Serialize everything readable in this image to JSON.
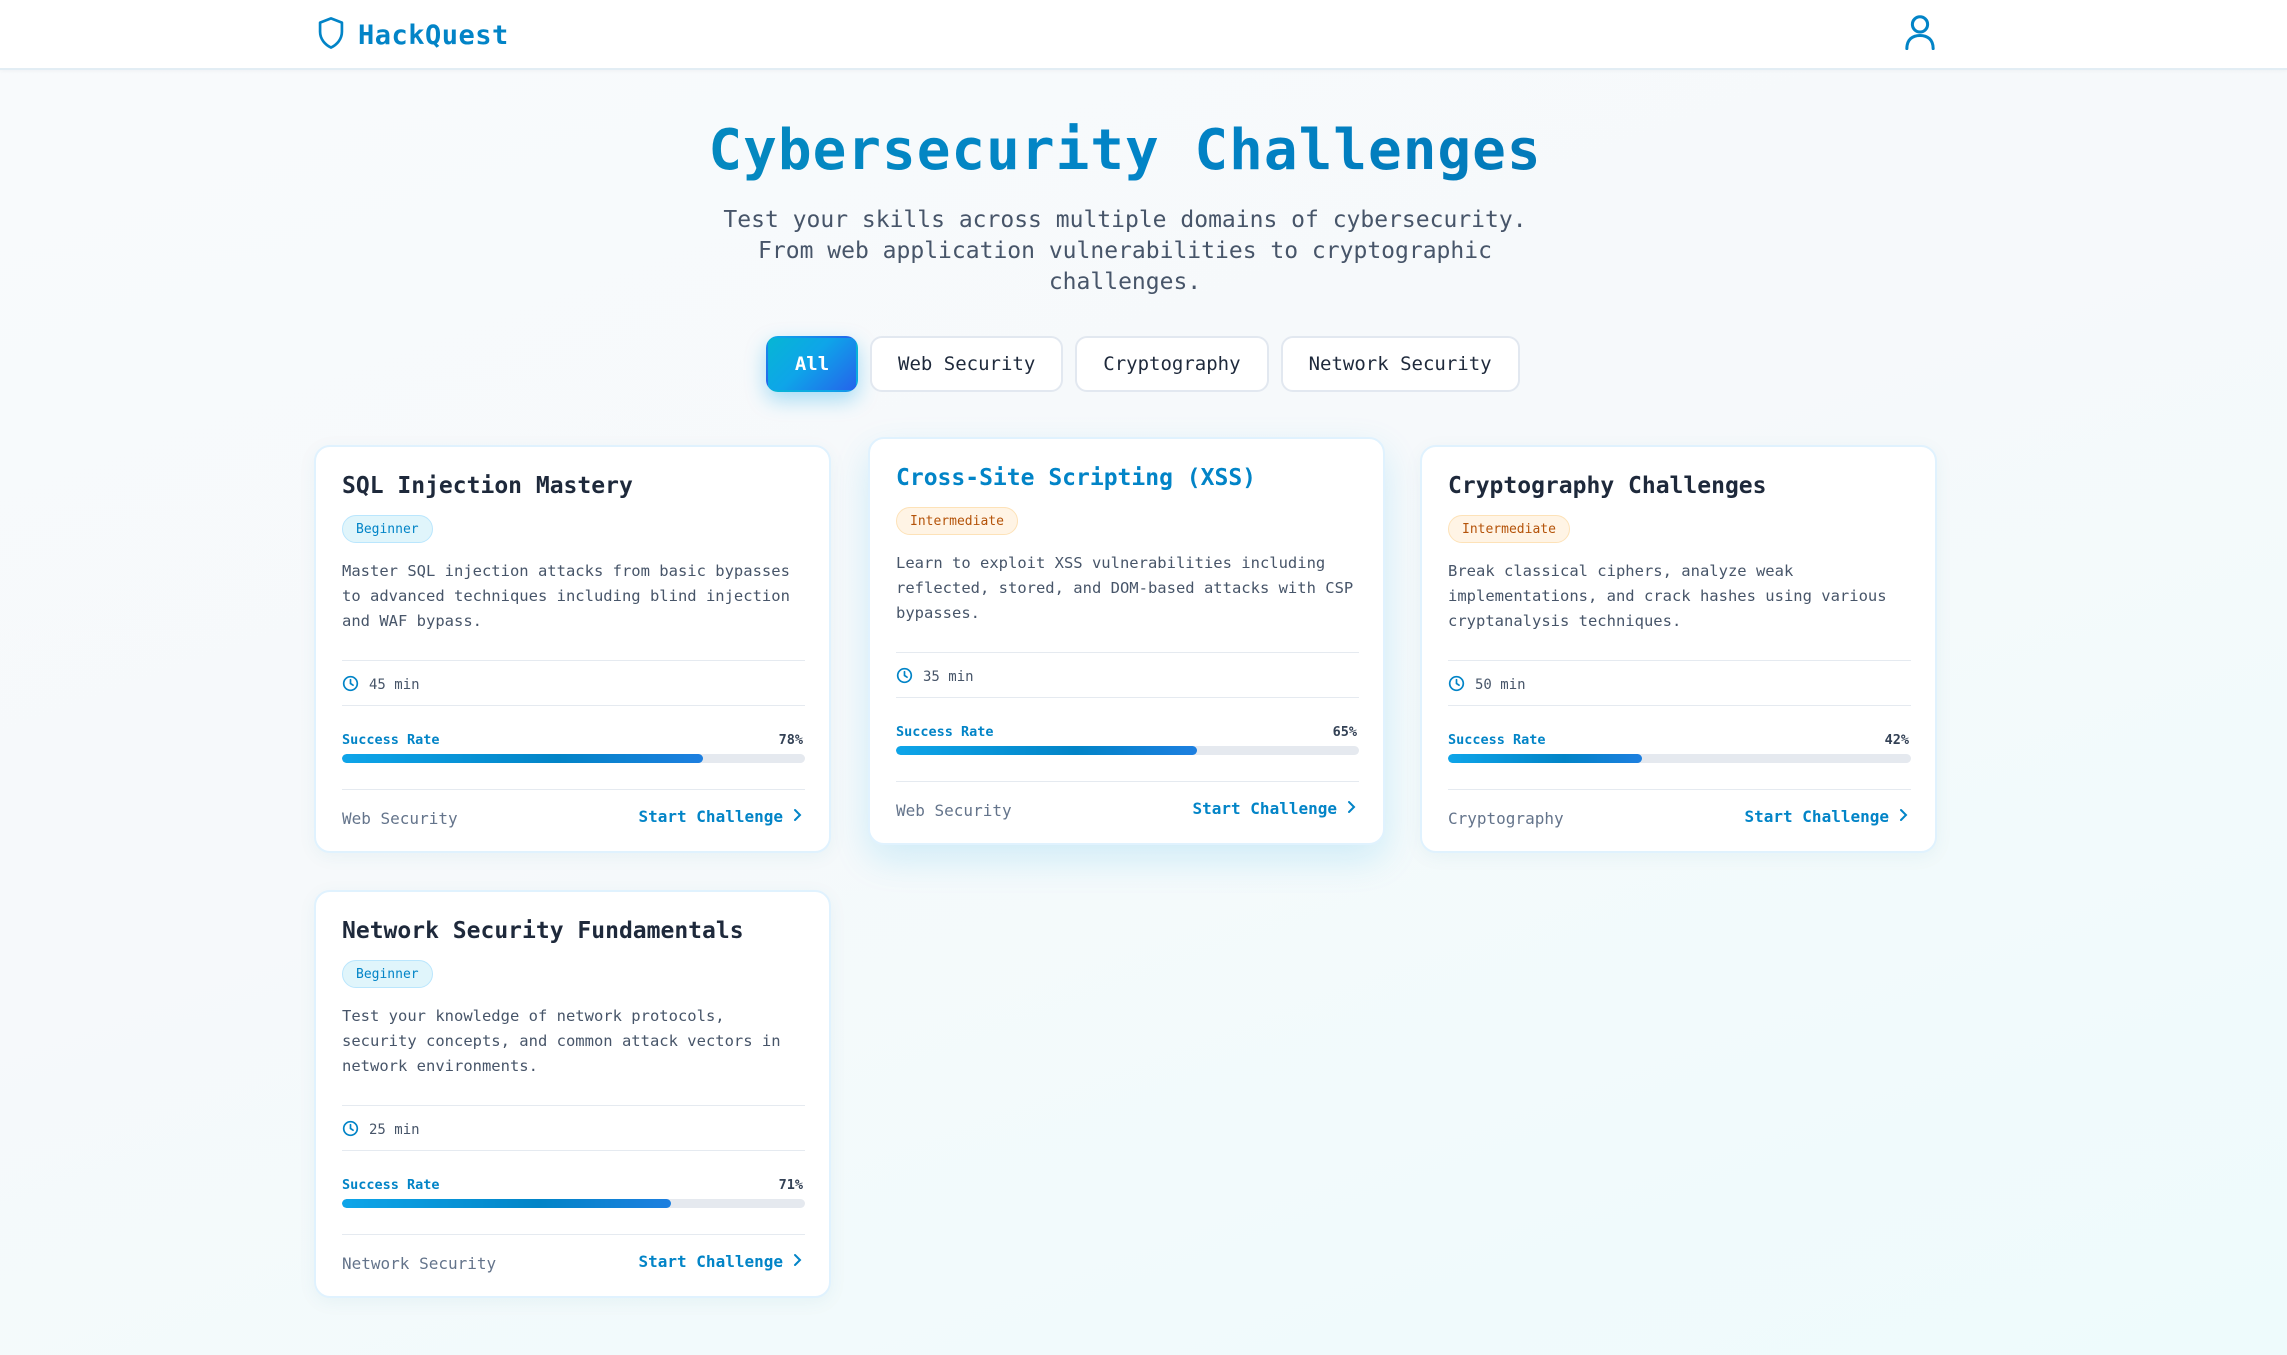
{
  "header": {
    "brand": "HackQuest",
    "brand_icon": "shield-icon",
    "user_icon": "user-icon"
  },
  "hero": {
    "title": "Cybersecurity Challenges",
    "subtitle": "Test your skills across multiple domains of cybersecurity. From web application vulnerabilities to cryptographic challenges."
  },
  "filters": [
    {
      "label": "All",
      "active": true
    },
    {
      "label": "Web Security",
      "active": false
    },
    {
      "label": "Cryptography",
      "active": false
    },
    {
      "label": "Network Security",
      "active": false
    }
  ],
  "colors": {
    "accent": "#0284c7",
    "beginner_bg": "#e0f5fb",
    "intermediate_bg": "#fff4e5"
  },
  "cards": [
    {
      "title": "SQL Injection Mastery",
      "level": "Beginner",
      "description": "Master SQL injection attacks from basic bypasses to advanced techniques including blind injection and WAF bypass.",
      "duration": "45 min",
      "rate_label": "Success Rate",
      "rate_text": "78%",
      "rate": 78,
      "category": "Web Security",
      "action": "Start Challenge"
    },
    {
      "title": "Cross-Site Scripting (XSS)",
      "level": "Intermediate",
      "description": "Learn to exploit XSS vulnerabilities including reflected, stored, and DOM-based attacks with CSP bypasses.",
      "duration": "35 min",
      "rate_label": "Success Rate",
      "rate_text": "65%",
      "rate": 65,
      "category": "Web Security",
      "action": "Start Challenge"
    },
    {
      "title": "Cryptography Challenges",
      "level": "Intermediate",
      "description": "Break classical ciphers, analyze weak implementations, and crack hashes using various cryptanalysis techniques.",
      "duration": "50 min",
      "rate_label": "Success Rate",
      "rate_text": "42%",
      "rate": 42,
      "category": "Cryptography",
      "action": "Start Challenge"
    },
    {
      "title": "Network Security Fundamentals",
      "level": "Beginner",
      "description": "Test your knowledge of network protocols, security concepts, and common attack vectors in network environments.",
      "duration": "25 min",
      "rate_label": "Success Rate",
      "rate_text": "71%",
      "rate": 71,
      "category": "Network Security",
      "action": "Start Challenge"
    }
  ]
}
